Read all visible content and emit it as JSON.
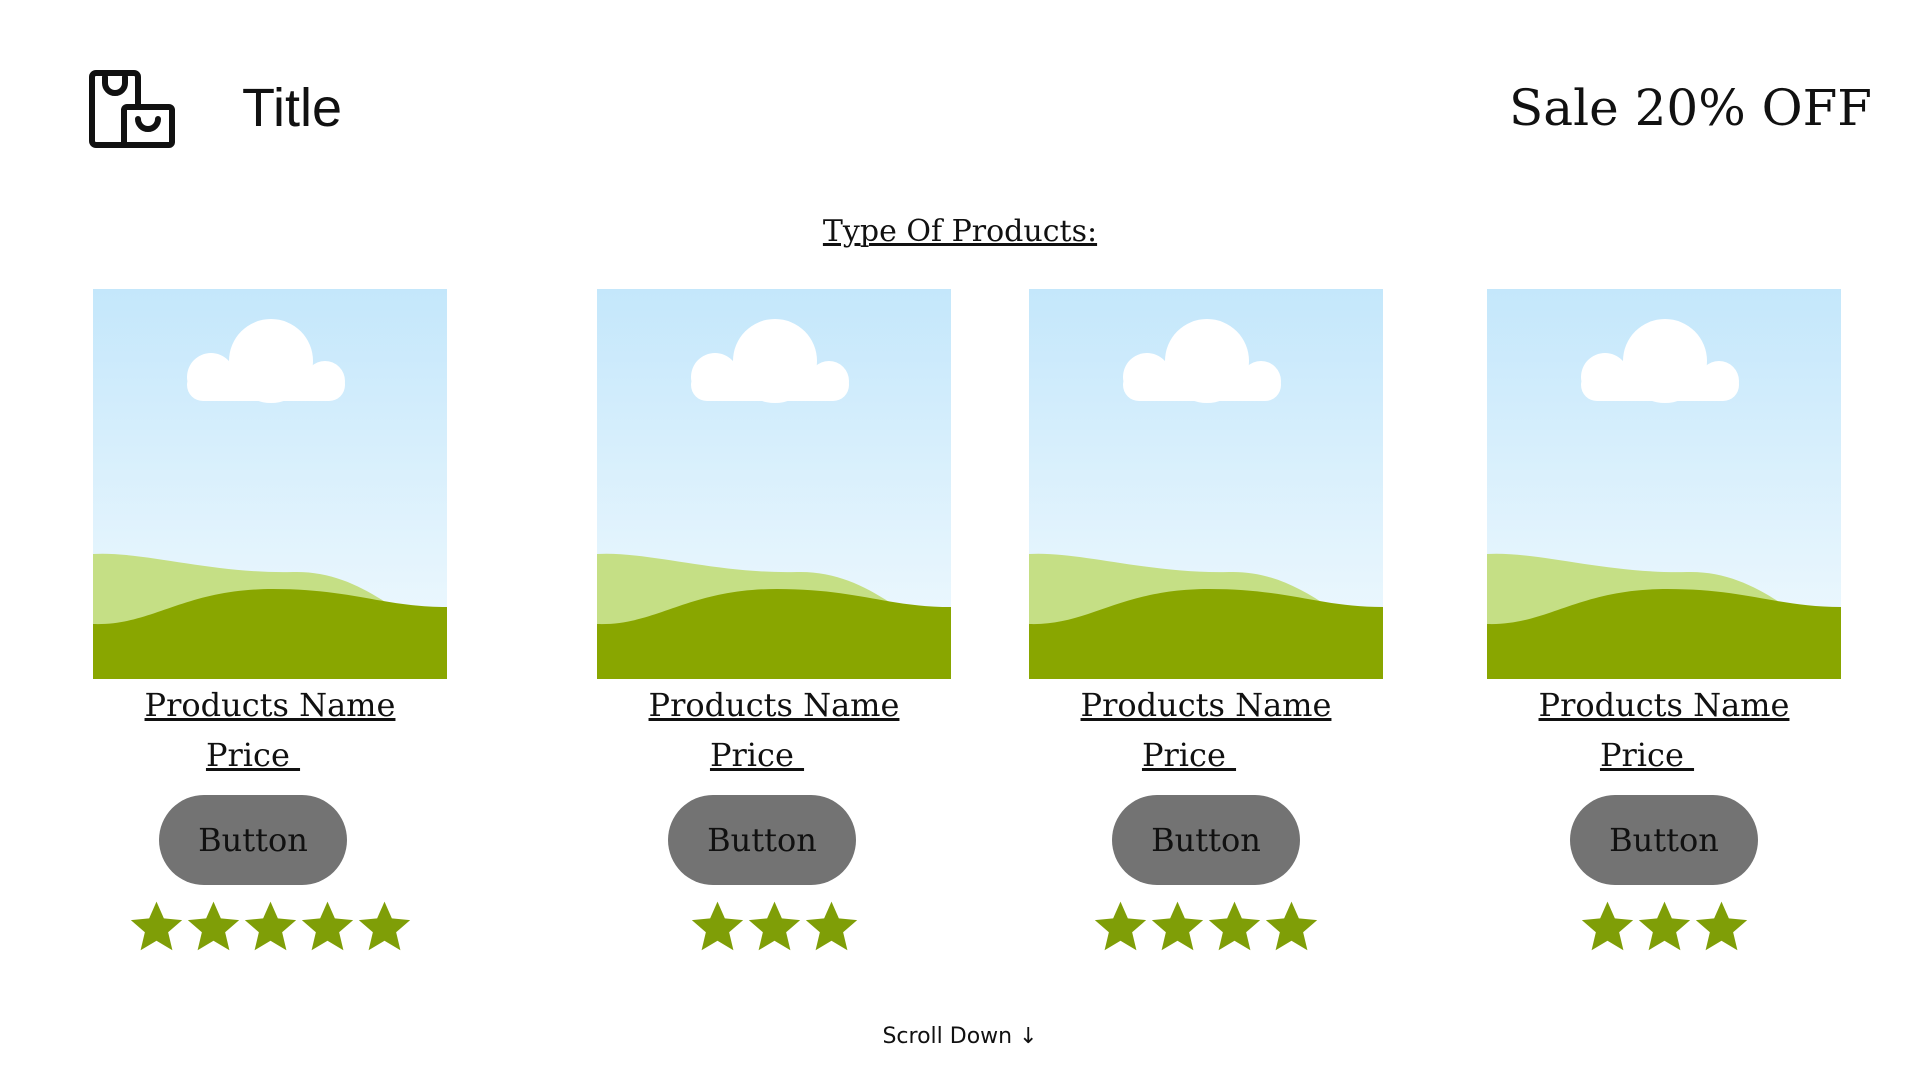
{
  "header": {
    "logo_icon": "shopping-bags-icon",
    "title": "Title",
    "sale_text": "Sale 20% OFF"
  },
  "section": {
    "heading": "Type Of Products:"
  },
  "products": [
    {
      "name": "Products Name",
      "price": "Price ",
      "button_label": "Button",
      "rating": 5
    },
    {
      "name": "Products Name",
      "price": "Price ",
      "button_label": "Button",
      "rating": 3
    },
    {
      "name": "Products Name",
      "price": "Price ",
      "button_label": "Button",
      "rating": 4
    },
    {
      "name": "Products Name",
      "price": "Price ",
      "button_label": "Button",
      "rating": 3
    }
  ],
  "footer": {
    "scroll_text": "Scroll Down ↓"
  },
  "colors": {
    "sky_top": "#c4e7fb",
    "sky_bottom": "#f2fafe",
    "hill_light": "#c5df85",
    "hill_dark": "#89a600",
    "star": "#7f9e07",
    "button_bg": "#737373"
  }
}
